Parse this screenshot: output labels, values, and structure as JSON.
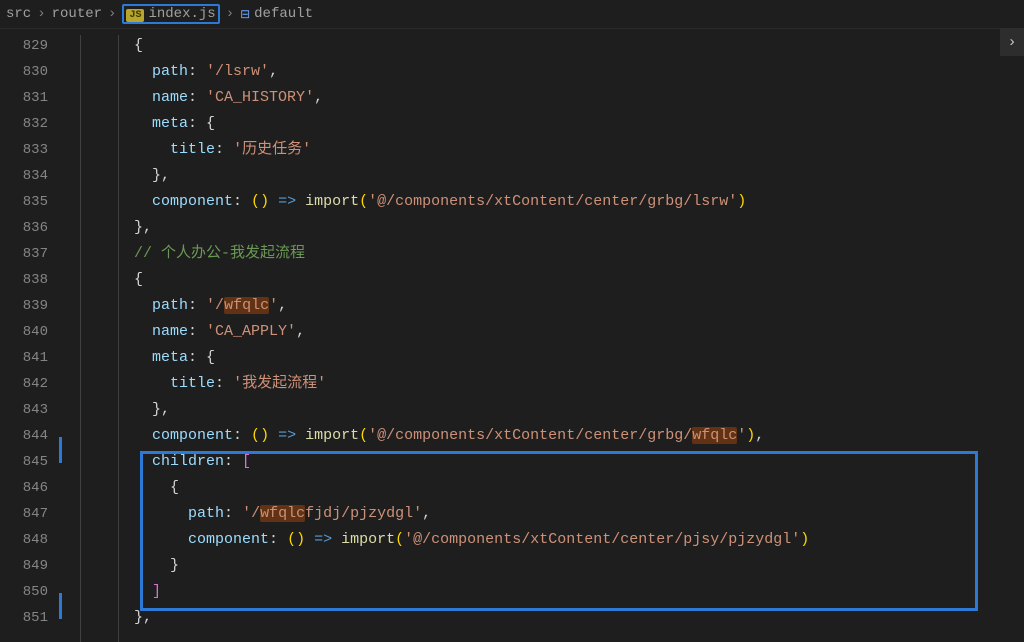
{
  "breadcrumbs": {
    "folder1": "src",
    "folder2": "router",
    "file": "index.js",
    "symbol_icon": "⊟",
    "symbol": "default"
  },
  "lines": {
    "start": 829,
    "end": 851
  },
  "code": {
    "l829": "{",
    "l830_key": "path",
    "l830_str": "'/lsrw'",
    "l831_key": "name",
    "l831_str": "'CA_HISTORY'",
    "l832_key": "meta",
    "l832_brace": "{",
    "l833_key": "title",
    "l833_str": "'历史任务'",
    "l834": "},",
    "l835_key": "component",
    "l835_arrow": "() =>",
    "l835_import": "import",
    "l835_str": "'@/components/xtContent/center/grbg/lsrw'",
    "l836": "},",
    "l837_comment": "// 个人办公-我发起流程",
    "l838": "{",
    "l839_key": "path",
    "l839_str_pre": "'/",
    "l839_hl": "wfqlc",
    "l839_str_post": "'",
    "l840_key": "name",
    "l840_str": "'CA_APPLY'",
    "l841_key": "meta",
    "l841_brace": "{",
    "l842_key": "title",
    "l842_str": "'我发起流程'",
    "l843": "},",
    "l844_key": "component",
    "l844_arrow": "() =>",
    "l844_import": "import",
    "l844_str_pre": "'@/components/xtContent/center/grbg/",
    "l844_hl": "wfqlc",
    "l844_str_post": "'",
    "l845_key": "children",
    "l845_brk": "[",
    "l846": "{",
    "l847_key": "path",
    "l847_str_pre": "'/",
    "l847_hl": "wfqlc",
    "l847_str_mid": "fjdj/pjzydgl'",
    "l848_key": "component",
    "l848_arrow": "() =>",
    "l848_import": "import",
    "l848_str": "'@/components/xtContent/center/pjsy/pjzydgl'",
    "l849": "}",
    "l850": "]",
    "l851": "},"
  },
  "ui": {
    "more": "›"
  },
  "colors": {
    "highlight_border": "#2c7ad6",
    "search_match_bg": "#613214"
  }
}
